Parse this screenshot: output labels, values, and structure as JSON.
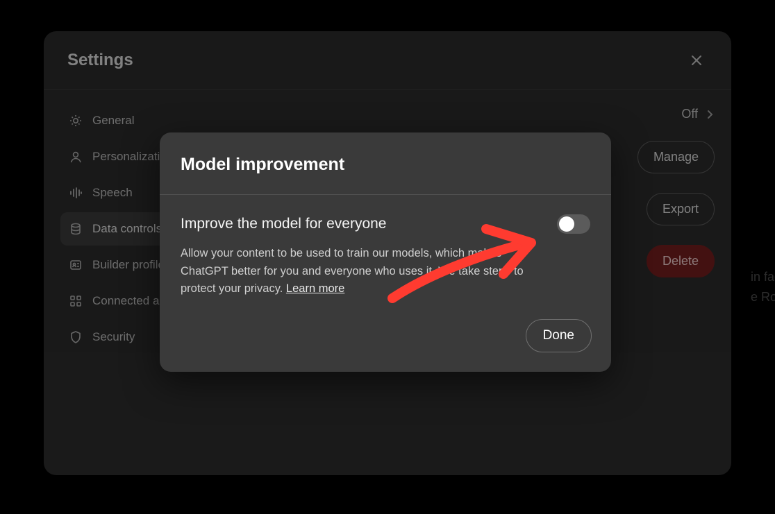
{
  "settings": {
    "title": "Settings",
    "nav": [
      {
        "label": "General"
      },
      {
        "label": "Personalization"
      },
      {
        "label": "Speech"
      },
      {
        "label": "Data controls"
      },
      {
        "label": "Builder profile"
      },
      {
        "label": "Connected apps"
      },
      {
        "label": "Security"
      }
    ],
    "right": {
      "off_label": "Off",
      "manage_label": "Manage",
      "export_label": "Export",
      "delete_label": "Delete"
    }
  },
  "modal": {
    "title": "Model improvement",
    "toggle_label": "Improve the model for everyone",
    "toggle_state": "off",
    "description_pre": "Allow your content to be used to train our models, which makes ChatGPT better for you and everyone who uses it. We take steps to protect your privacy. ",
    "learn_more": "Learn more",
    "done_label": "Done"
  },
  "background_text": "in fact\ne Rom",
  "annotation": {
    "color": "#ff3b30",
    "kind": "arrow-right"
  }
}
